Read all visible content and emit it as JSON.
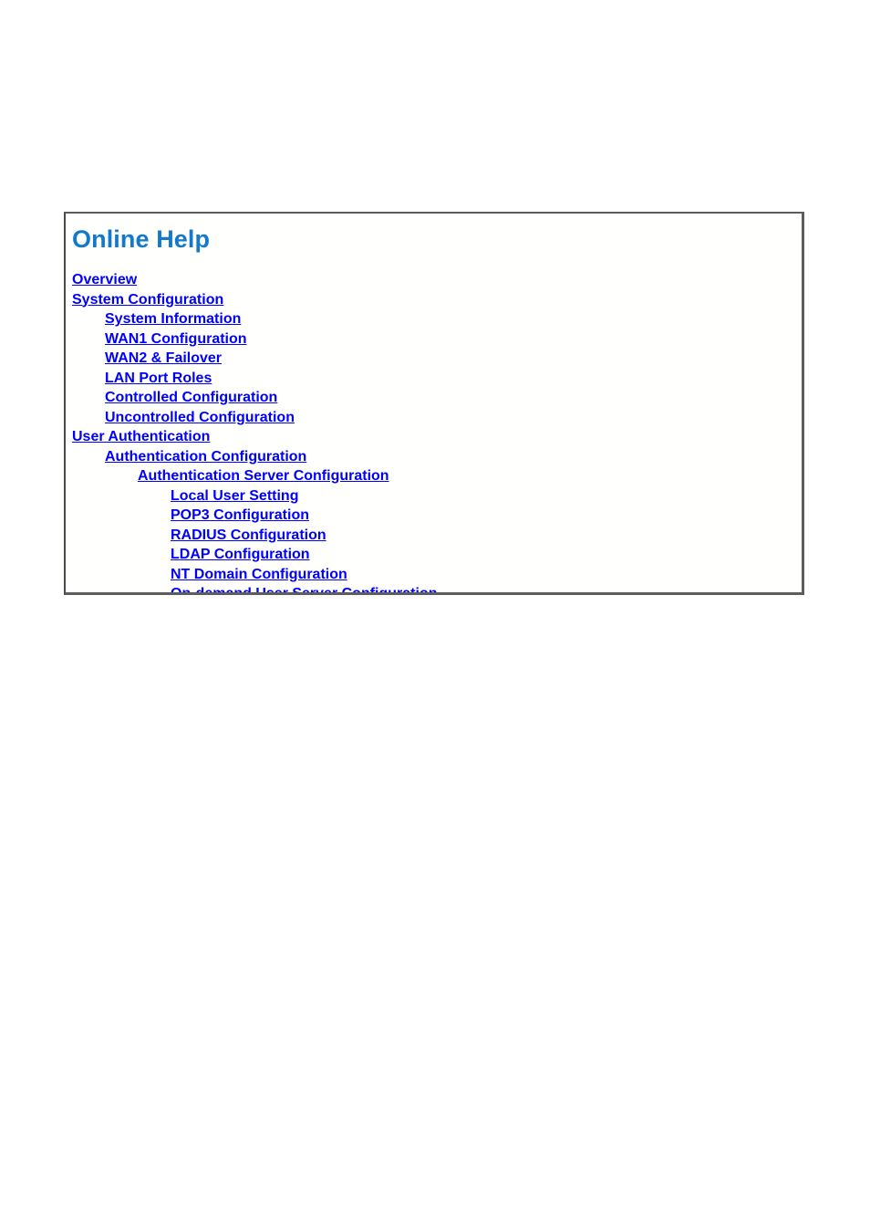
{
  "page": {
    "background_color": "#ffffff"
  },
  "help_panel": {
    "title": "Online Help",
    "title_color": "#1379CE",
    "link_color": "#0000FF",
    "border_color": "#5D5D5D",
    "background_color": "#FFFFFE",
    "toc": [
      {
        "label": "Overview",
        "level": 0
      },
      {
        "label": "System Configuration",
        "level": 0
      },
      {
        "label": "System Information",
        "level": 1
      },
      {
        "label": "WAN1 Configuration",
        "level": 1
      },
      {
        "label": "WAN2 & Failover",
        "level": 1
      },
      {
        "label": "LAN Port Roles",
        "level": 1
      },
      {
        "label": "Controlled Configuration",
        "level": 1
      },
      {
        "label": "Uncontrolled Configuration",
        "level": 1
      },
      {
        "label": "User Authentication",
        "level": 0
      },
      {
        "label": "Authentication Configuration",
        "level": 1
      },
      {
        "label": "Authentication Server Configuration",
        "level": 2
      },
      {
        "label": "Local User Setting",
        "level": 3
      },
      {
        "label": "POP3 Configuration",
        "level": 3
      },
      {
        "label": "RADIUS Configuration",
        "level": 3
      },
      {
        "label": "LDAP Configuration",
        "level": 3
      },
      {
        "label": "NT Domain Configuration",
        "level": 3
      },
      {
        "label": "On-demand User Server Configuration",
        "level": 3
      }
    ]
  }
}
